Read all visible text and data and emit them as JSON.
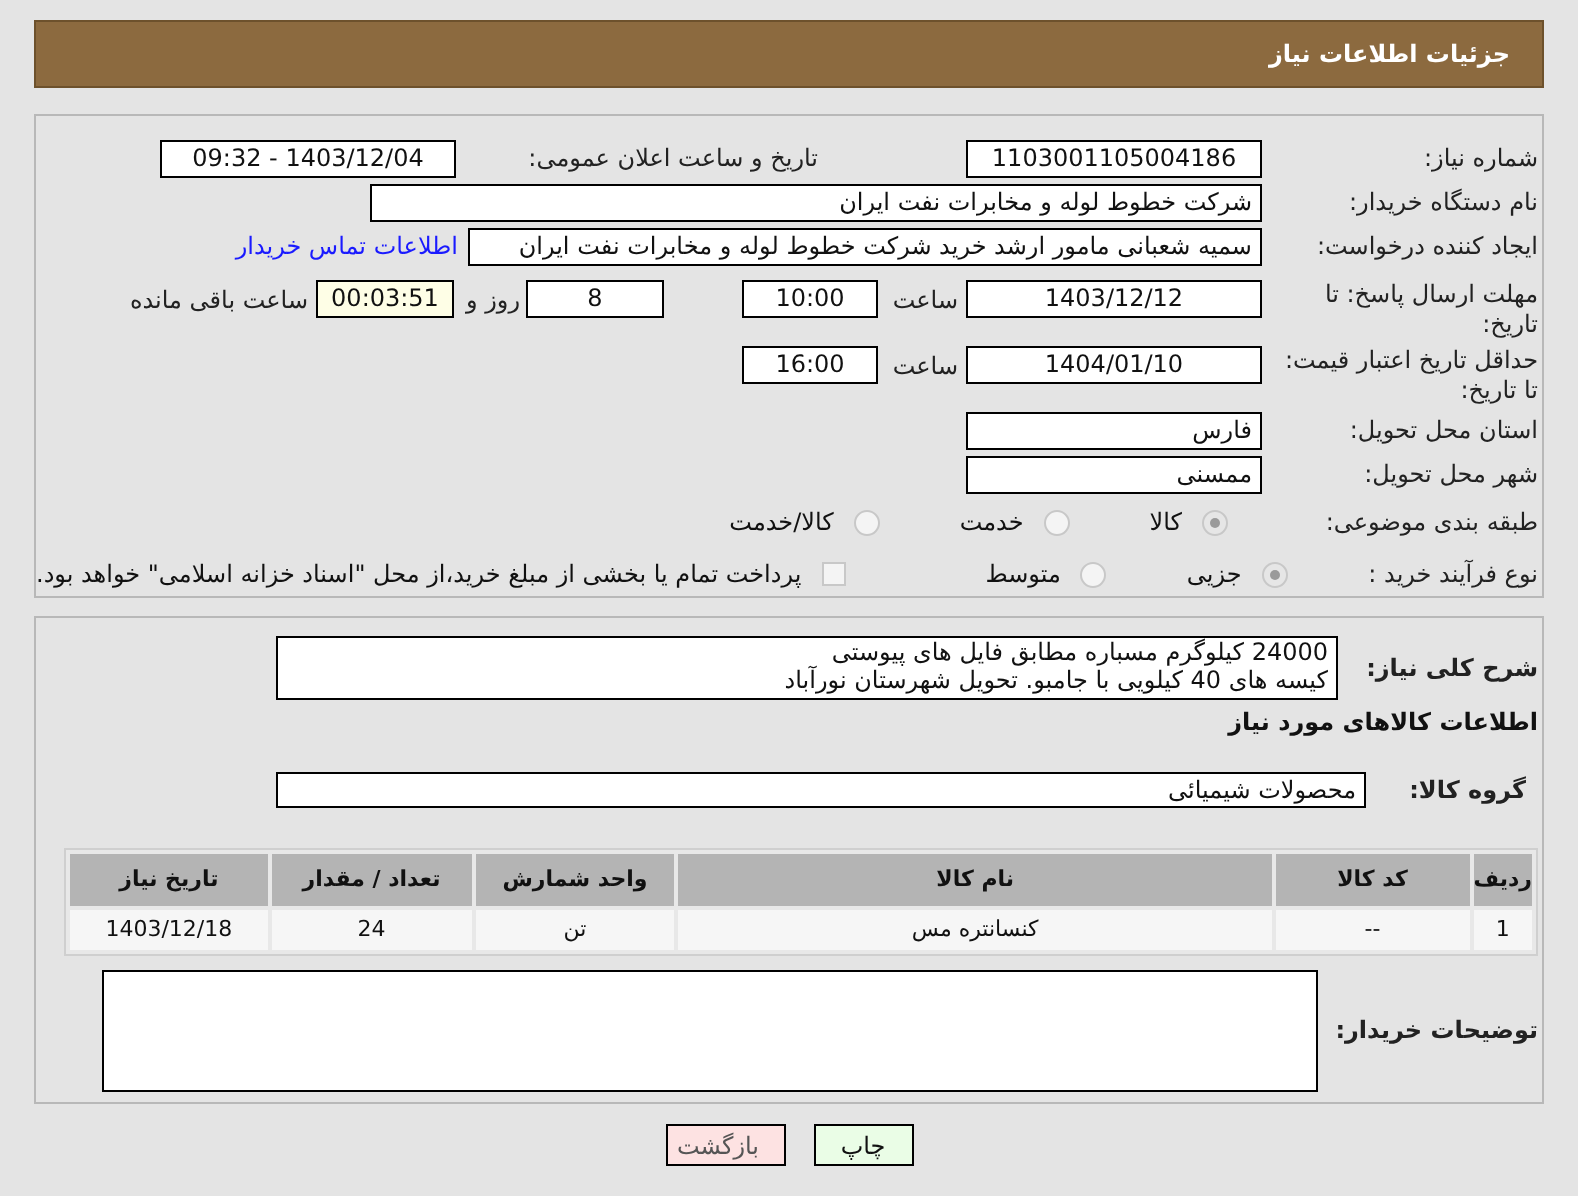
{
  "header": {
    "title": "جزئیات اطلاعات نیاز"
  },
  "need_number": {
    "label": "شماره نیاز:",
    "value": "1103001105004186"
  },
  "announce": {
    "label": "تاریخ و ساعت اعلان عمومی:",
    "value": "1403/12/04 - 09:32"
  },
  "buyer": {
    "label": "نام دستگاه خریدار:",
    "value": "شرکت خطوط لوله و مخابرات نفت ایران"
  },
  "creator": {
    "label": "ایجاد کننده درخواست:",
    "value": "سمیه شعبانی مامور ارشد خرید  شرکت خطوط لوله و مخابرات نفت ایران",
    "link": "اطلاعات تماس خریدار"
  },
  "deadline": {
    "label": "مهلت ارسال پاسخ: تا تاریخ:",
    "date": "1403/12/12",
    "time_label": "ساعت",
    "time": "10:00",
    "days": "8",
    "days_label": "روز و",
    "remaining": "00:03:51",
    "remaining_label": "ساعت باقی مانده"
  },
  "validity": {
    "label": "حداقل تاریخ اعتبار قیمت: تا تاریخ:",
    "date": "1404/01/10",
    "time_label": "ساعت",
    "time": "16:00"
  },
  "province": {
    "label": "استان محل تحویل:",
    "value": "فارس"
  },
  "city": {
    "label": "شهر محل تحویل:",
    "value": "ممسنی"
  },
  "category": {
    "label": "طبقه بندی موضوعی:",
    "options": [
      {
        "label": "کالا",
        "selected": true
      },
      {
        "label": "خدمت",
        "selected": false
      },
      {
        "label": "کالا/خدمت",
        "selected": false
      }
    ]
  },
  "process": {
    "label": "نوع فرآیند خرید :",
    "options": [
      {
        "label": "جزیی",
        "selected": true
      },
      {
        "label": "متوسط",
        "selected": false
      }
    ],
    "payment": {
      "label": "پرداخت تمام یا بخشی از مبلغ خرید،از محل \"اسناد خزانه اسلامی\" خواهد بود.",
      "checked": false
    }
  },
  "description": {
    "label": "شرح کلی نیاز:",
    "lines": [
      "24000 کیلوگرم مسباره مطابق فایل های پیوستی",
      "کیسه های 40 کیلویی با جامبو. تحویل شهرستان نورآباد"
    ]
  },
  "goods_title": "اطلاعات کالاهای مورد نیاز",
  "group": {
    "label": "گروه کالا:",
    "value": "محصولات شیمیائی"
  },
  "table": {
    "columns": [
      "ردیف",
      "کد کالا",
      "نام کالا",
      "واحد شمارش",
      "تعداد / مقدار",
      "تاریخ نیاز"
    ],
    "rows": [
      [
        "1",
        "--",
        "کنسانتره مس",
        "تن",
        "24",
        "1403/12/18"
      ]
    ]
  },
  "notes": {
    "label": "توضیحات خریدار:"
  },
  "buttons": [
    {
      "label": "چاپ",
      "kind": "print"
    },
    {
      "label": "بازگشت",
      "kind": "back"
    }
  ]
}
